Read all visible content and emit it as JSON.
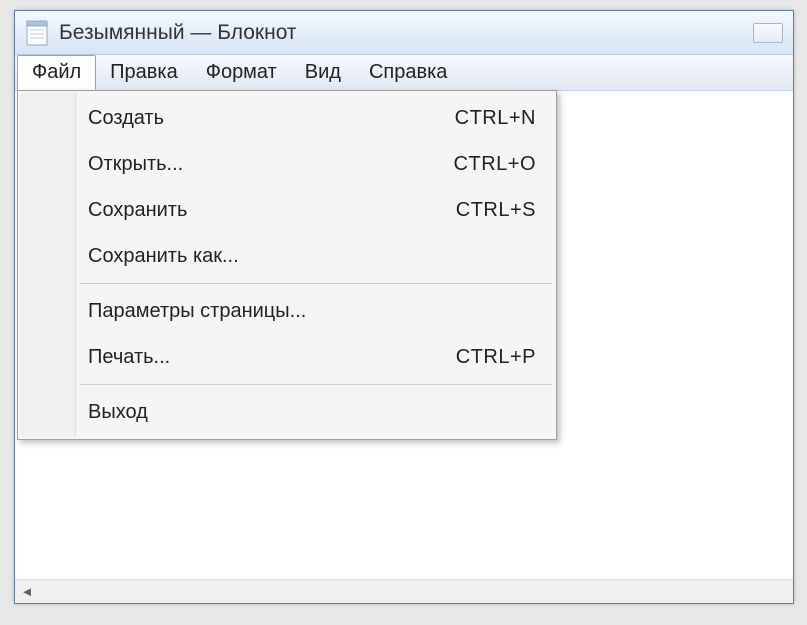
{
  "window": {
    "title": "Безымянный — Блокнот"
  },
  "menubar": {
    "items": [
      {
        "label": "Файл",
        "active": true
      },
      {
        "label": "Правка"
      },
      {
        "label": "Формат"
      },
      {
        "label": "Вид"
      },
      {
        "label": "Справка"
      }
    ]
  },
  "file_menu": {
    "groups": [
      [
        {
          "label": "Создать",
          "shortcut": "CTRL+N"
        },
        {
          "label": "Открыть...",
          "shortcut": "CTRL+O"
        },
        {
          "label": "Сохранить",
          "shortcut": "CTRL+S"
        },
        {
          "label": "Сохранить как...",
          "shortcut": ""
        }
      ],
      [
        {
          "label": "Параметры страницы...",
          "shortcut": ""
        },
        {
          "label": "Печать...",
          "shortcut": "CTRL+P"
        }
      ],
      [
        {
          "label": "Выход",
          "shortcut": ""
        }
      ]
    ]
  }
}
